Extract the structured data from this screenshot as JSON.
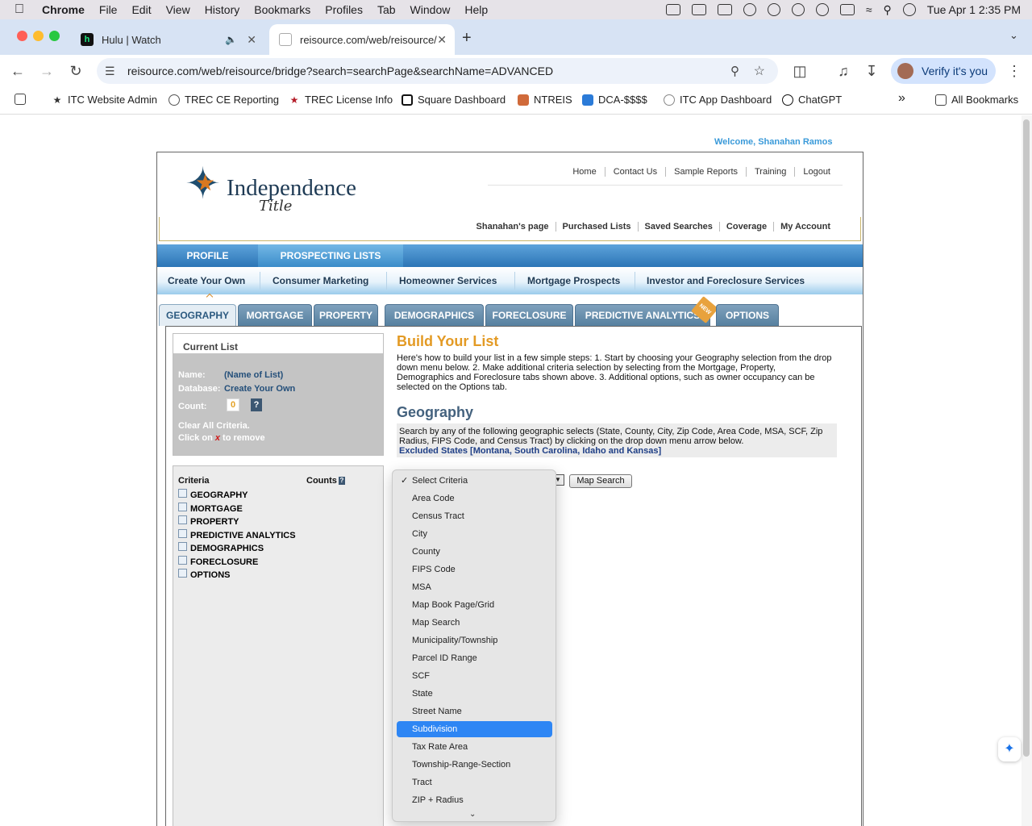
{
  "menubar": {
    "app": "Chrome",
    "menus": [
      "File",
      "Edit",
      "View",
      "History",
      "Bookmarks",
      "Profiles",
      "Tab",
      "Window",
      "Help"
    ],
    "clock": "Tue Apr 1  2:35 PM"
  },
  "tabs": [
    {
      "title": "Hulu | Watch",
      "favicon": "h"
    },
    {
      "title": "reisource.com/web/reisource/"
    }
  ],
  "address": {
    "url": "reisource.com/web/reisource/bridge?search=searchPage&searchName=ADVANCED",
    "verify_label": "Verify it's you"
  },
  "bookmarks": {
    "items": [
      "ITC Website Admin",
      "TREC CE Reporting",
      "TREC License Info",
      "Square Dashboard",
      "NTREIS",
      "DCA-$$$$",
      "ITC App Dashboard",
      "ChatGPT"
    ],
    "overflow": "»",
    "all": "All Bookmarks"
  },
  "site": {
    "welcome": "Welcome, Shanahan Ramos",
    "logo_word": "Independence",
    "logo_sub": "Title",
    "top_links": [
      "Home",
      "Contact Us",
      "Sample Reports",
      "Training",
      "Logout"
    ],
    "user_links": [
      "Shanahan's page",
      "Purchased Lists",
      "Saved Searches",
      "Coverage",
      "My Account"
    ],
    "main_tabs": [
      "PROFILE",
      "PROSPECTING LISTS"
    ],
    "sub_tabs": [
      "Create Your Own",
      "Consumer Marketing",
      "Homeowner Services",
      "Mortgage Prospects",
      "Investor and Foreclosure Services"
    ],
    "criteria_tabs": [
      "GEOGRAPHY",
      "MORTGAGE",
      "PROPERTY",
      "DEMOGRAPHICS",
      "FORECLOSURE",
      "PREDICTIVE ANALYTICS",
      "OPTIONS"
    ],
    "new_tag": "NEW"
  },
  "current_list": {
    "header": "Current List",
    "name_label": "Name:",
    "name_value": "(Name of List)",
    "database_label": "Database:",
    "database_value": "Create Your Own",
    "count_label": "Count:",
    "count_value": "0",
    "help": "?",
    "clear_text": "Clear All Criteria.",
    "click_text_a": "Click on",
    "click_x": "x",
    "click_text_b": "to remove"
  },
  "criteria": {
    "criteria_header": "Criteria",
    "counts_header": "Counts",
    "counts_help": "?",
    "items": [
      "GEOGRAPHY",
      "MORTGAGE",
      "PROPERTY",
      "PREDICTIVE ANALYTICS",
      "DEMOGRAPHICS",
      "FORECLOSURE",
      "OPTIONS"
    ]
  },
  "build": {
    "title": "Build Your List",
    "text": "Here's how to build your list in a few simple steps: 1. Start by choosing your Geography selection from the drop down menu below. 2. Make additional criteria selection by selecting from the Mortgage, Property, Demographics and Foreclosure tabs shown above. 3. Additional options, such as owner occupancy can be selected on the Options tab."
  },
  "geography": {
    "title": "Geography",
    "text": "Search by any of the following geographic selects (State, County, City, Zip Code, Area Code, MSA, SCF, Zip Radius, FIPS Code, and Census Tract) by clicking on the drop down menu arrow below.",
    "excluded": "Excluded States [Montana, South Carolina, Idaho and Kansas]",
    "map_button": "Map Search"
  },
  "dropdown": {
    "selected": "Select Criteria",
    "highlighted": "Subdivision",
    "options": [
      "Select Criteria",
      "Area Code",
      "Census Tract",
      "City",
      "County",
      "FIPS Code",
      "MSA",
      "Map Book Page/Grid",
      "Map Search",
      "Municipality/Township",
      "Parcel ID Range",
      "SCF",
      "State",
      "Street Name",
      "Subdivision",
      "Tax Rate Area",
      "Township-Range-Section",
      "Tract",
      "ZIP + Radius"
    ]
  },
  "colors": {
    "accent_orange": "#e39a24",
    "nav_blue": "#2b75b6",
    "highlight_blue": "#2e86f4"
  }
}
